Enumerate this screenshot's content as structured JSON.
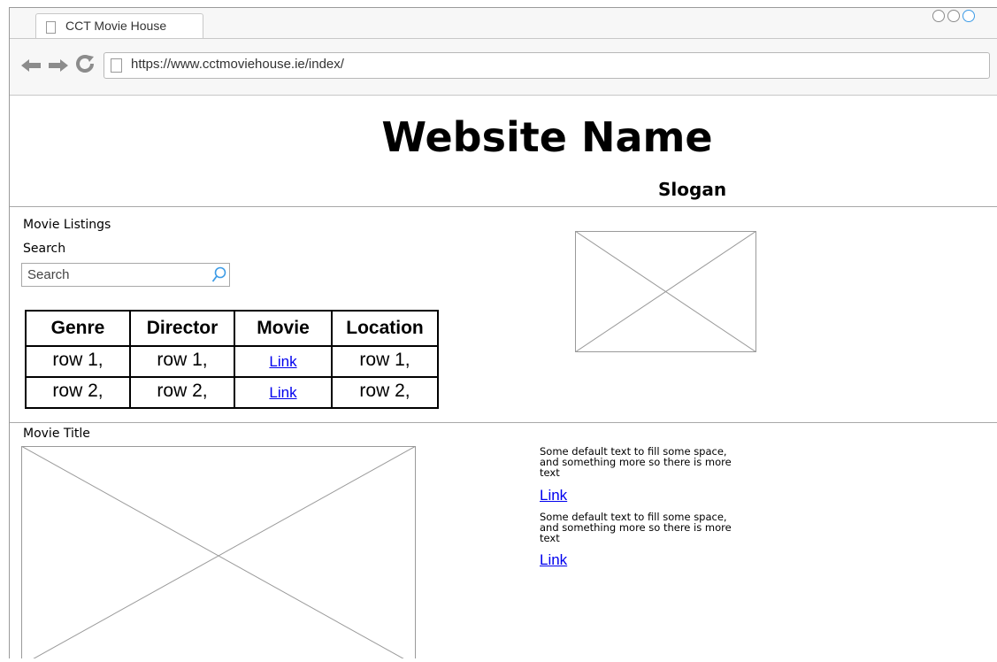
{
  "browser": {
    "tab_title": "CCT Movie House",
    "url": "https://www.cctmoviehouse.ie/index/"
  },
  "header": {
    "site_name": "Website Name",
    "slogan": "Slogan"
  },
  "listings": {
    "heading": "Movie Listings",
    "search_label": "Search",
    "search_placeholder": "Search",
    "columns": [
      "Genre",
      "Director",
      "Movie",
      "Location"
    ],
    "rows": [
      [
        "row 1,",
        "row 1,",
        "Link",
        "row 1,"
      ],
      [
        "row 2,",
        "row 2,",
        "Link",
        "row 2,"
      ]
    ]
  },
  "movie": {
    "title_label": "Movie Title",
    "blurbs": [
      {
        "text": "Some default text to fill some space, and something more so there is more text",
        "link": "Link"
      },
      {
        "text": "Some default text to fill some space, and something more so there is more text",
        "link": "Link"
      }
    ]
  },
  "colors": {
    "link": "#0000ee",
    "window_control_active": "#3c9be6"
  }
}
